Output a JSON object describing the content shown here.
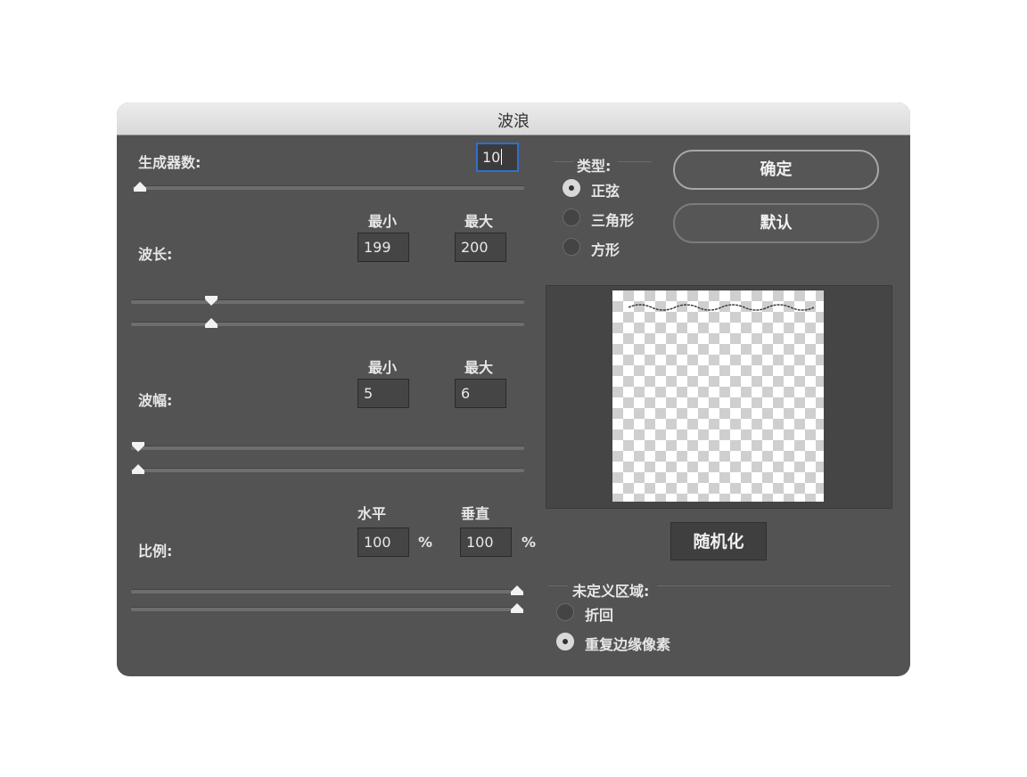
{
  "dialog": {
    "title": "波浪"
  },
  "generators": {
    "label": "生成器数:",
    "value": "10"
  },
  "wavelength": {
    "label": "波长:",
    "min_label": "最小",
    "max_label": "最大",
    "min": "199",
    "max": "200"
  },
  "amplitude": {
    "label": "波幅:",
    "min_label": "最小",
    "max_label": "最大",
    "min": "5",
    "max": "6"
  },
  "scale": {
    "label": "比例:",
    "h_label": "水平",
    "v_label": "垂直",
    "h": "100",
    "v": "100",
    "unit": "%"
  },
  "type": {
    "label": "类型:",
    "options": [
      {
        "label": "正弦",
        "selected": true
      },
      {
        "label": "三角形",
        "selected": false
      },
      {
        "label": "方形",
        "selected": false
      }
    ]
  },
  "buttons": {
    "ok": "确定",
    "default": "默认",
    "randomize": "随机化"
  },
  "undefined_area": {
    "label": "未定义区域:",
    "options": [
      {
        "label": "折回",
        "selected": false
      },
      {
        "label": "重复边缘像素",
        "selected": true
      }
    ]
  },
  "colors": {
    "panel": "#535353",
    "focus": "#2f6fd0"
  }
}
